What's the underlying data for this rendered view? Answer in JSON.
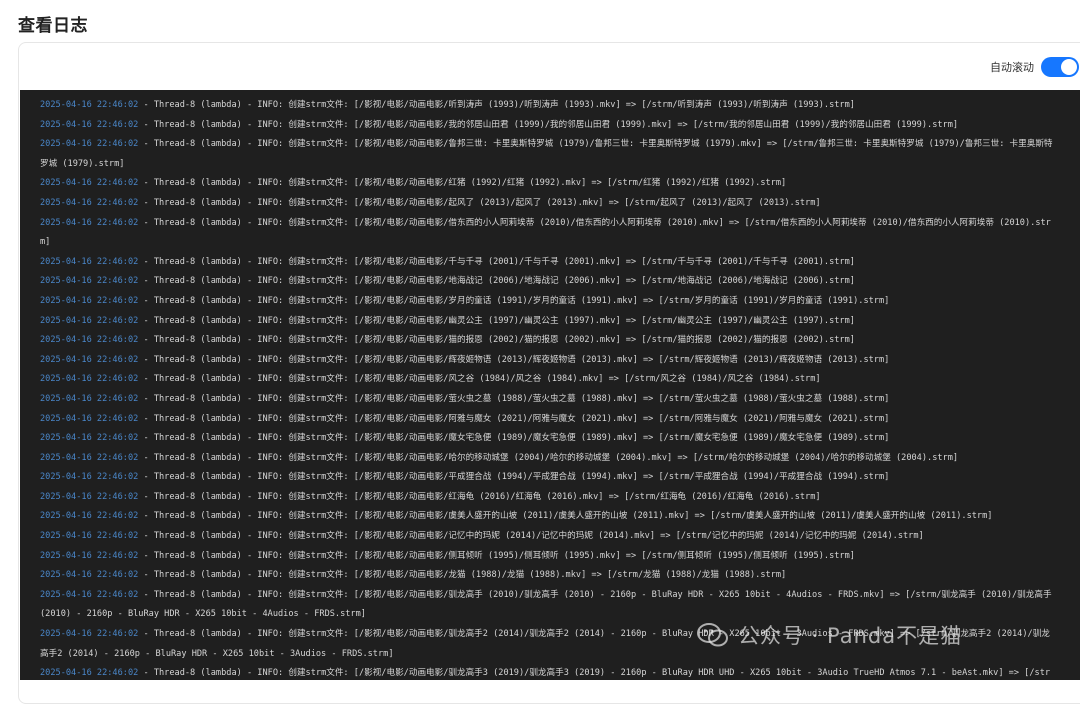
{
  "page": {
    "title": "查看日志"
  },
  "toolbar": {
    "autoscroll_label": "自动滚动",
    "autoscroll_on": true
  },
  "colors": {
    "accent": "#1677ff",
    "log_bg": "#1f1f1f",
    "timestamp": "#4a86c8",
    "log_text": "#d6d6d6"
  },
  "logs": [
    {
      "time": "2025-04-16 22:46:02",
      "text": " - Thread-8 (lambda) - INFO: 创建strm文件: [/影视/电影/动画电影/听到涛声 (1993)/听到涛声 (1993).mkv] => [/strm/听到涛声 (1993)/听到涛声 (1993).strm]"
    },
    {
      "time": "2025-04-16 22:46:02",
      "text": " - Thread-8 (lambda) - INFO: 创建strm文件: [/影视/电影/动画电影/我的邻居山田君 (1999)/我的邻居山田君 (1999).mkv] => [/strm/我的邻居山田君 (1999)/我的邻居山田君 (1999).strm]"
    },
    {
      "time": "2025-04-16 22:46:02",
      "text": " - Thread-8 (lambda) - INFO: 创建strm文件: [/影视/电影/动画电影/鲁邦三世: 卡里奥斯特罗城 (1979)/鲁邦三世: 卡里奥斯特罗城 (1979).mkv] => [/strm/鲁邦三世: 卡里奥斯特罗城 (1979)/鲁邦三世: 卡里奥斯特罗城 (1979).strm]"
    },
    {
      "time": "2025-04-16 22:46:02",
      "text": " - Thread-8 (lambda) - INFO: 创建strm文件: [/影视/电影/动画电影/红猪 (1992)/红猪 (1992).mkv] => [/strm/红猪 (1992)/红猪 (1992).strm]"
    },
    {
      "time": "2025-04-16 22:46:02",
      "text": " - Thread-8 (lambda) - INFO: 创建strm文件: [/影视/电影/动画电影/起风了 (2013)/起风了 (2013).mkv] => [/strm/起风了 (2013)/起风了 (2013).strm]"
    },
    {
      "time": "2025-04-16 22:46:02",
      "text": " - Thread-8 (lambda) - INFO: 创建strm文件: [/影视/电影/动画电影/借东西的小人阿莉埃蒂 (2010)/借东西的小人阿莉埃蒂 (2010).mkv] => [/strm/借东西的小人阿莉埃蒂 (2010)/借东西的小人阿莉埃蒂 (2010).strm]"
    },
    {
      "time": "2025-04-16 22:46:02",
      "text": " - Thread-8 (lambda) - INFO: 创建strm文件: [/影视/电影/动画电影/千与千寻 (2001)/千与千寻 (2001).mkv] => [/strm/千与千寻 (2001)/千与千寻 (2001).strm]"
    },
    {
      "time": "2025-04-16 22:46:02",
      "text": " - Thread-8 (lambda) - INFO: 创建strm文件: [/影视/电影/动画电影/地海战记 (2006)/地海战记 (2006).mkv] => [/strm/地海战记 (2006)/地海战记 (2006).strm]"
    },
    {
      "time": "2025-04-16 22:46:02",
      "text": " - Thread-8 (lambda) - INFO: 创建strm文件: [/影视/电影/动画电影/岁月的童话 (1991)/岁月的童话 (1991).mkv] => [/strm/岁月的童话 (1991)/岁月的童话 (1991).strm]"
    },
    {
      "time": "2025-04-16 22:46:02",
      "text": " - Thread-8 (lambda) - INFO: 创建strm文件: [/影视/电影/动画电影/幽灵公主 (1997)/幽灵公主 (1997).mkv] => [/strm/幽灵公主 (1997)/幽灵公主 (1997).strm]"
    },
    {
      "time": "2025-04-16 22:46:02",
      "text": " - Thread-8 (lambda) - INFO: 创建strm文件: [/影视/电影/动画电影/猫的报恩 (2002)/猫的报恩 (2002).mkv] => [/strm/猫的报恩 (2002)/猫的报恩 (2002).strm]"
    },
    {
      "time": "2025-04-16 22:46:02",
      "text": " - Thread-8 (lambda) - INFO: 创建strm文件: [/影视/电影/动画电影/辉夜姬物语 (2013)/辉夜姬物语 (2013).mkv] => [/strm/辉夜姬物语 (2013)/辉夜姬物语 (2013).strm]"
    },
    {
      "time": "2025-04-16 22:46:02",
      "text": " - Thread-8 (lambda) - INFO: 创建strm文件: [/影视/电影/动画电影/风之谷 (1984)/风之谷 (1984).mkv] => [/strm/风之谷 (1984)/风之谷 (1984).strm]"
    },
    {
      "time": "2025-04-16 22:46:02",
      "text": " - Thread-8 (lambda) - INFO: 创建strm文件: [/影视/电影/动画电影/萤火虫之墓 (1988)/萤火虫之墓 (1988).mkv] => [/strm/萤火虫之墓 (1988)/萤火虫之墓 (1988).strm]"
    },
    {
      "time": "2025-04-16 22:46:02",
      "text": " - Thread-8 (lambda) - INFO: 创建strm文件: [/影视/电影/动画电影/阿雅与魔女 (2021)/阿雅与魔女 (2021).mkv] => [/strm/阿雅与魔女 (2021)/阿雅与魔女 (2021).strm]"
    },
    {
      "time": "2025-04-16 22:46:02",
      "text": " - Thread-8 (lambda) - INFO: 创建strm文件: [/影视/电影/动画电影/魔女宅急便 (1989)/魔女宅急便 (1989).mkv] => [/strm/魔女宅急便 (1989)/魔女宅急便 (1989).strm]"
    },
    {
      "time": "2025-04-16 22:46:02",
      "text": " - Thread-8 (lambda) - INFO: 创建strm文件: [/影视/电影/动画电影/哈尔的移动城堡 (2004)/哈尔的移动城堡 (2004).mkv] => [/strm/哈尔的移动城堡 (2004)/哈尔的移动城堡 (2004).strm]"
    },
    {
      "time": "2025-04-16 22:46:02",
      "text": " - Thread-8 (lambda) - INFO: 创建strm文件: [/影视/电影/动画电影/平成狸合战 (1994)/平成狸合战 (1994).mkv] => [/strm/平成狸合战 (1994)/平成狸合战 (1994).strm]"
    },
    {
      "time": "2025-04-16 22:46:02",
      "text": " - Thread-8 (lambda) - INFO: 创建strm文件: [/影视/电影/动画电影/红海龟 (2016)/红海龟 (2016).mkv] => [/strm/红海龟 (2016)/红海龟 (2016).strm]"
    },
    {
      "time": "2025-04-16 22:46:02",
      "text": " - Thread-8 (lambda) - INFO: 创建strm文件: [/影视/电影/动画电影/虞美人盛开的山坡 (2011)/虞美人盛开的山坡 (2011).mkv] => [/strm/虞美人盛开的山坡 (2011)/虞美人盛开的山坡 (2011).strm]"
    },
    {
      "time": "2025-04-16 22:46:02",
      "text": " - Thread-8 (lambda) - INFO: 创建strm文件: [/影视/电影/动画电影/记忆中的玛妮 (2014)/记忆中的玛妮 (2014).mkv] => [/strm/记忆中的玛妮 (2014)/记忆中的玛妮 (2014).strm]"
    },
    {
      "time": "2025-04-16 22:46:02",
      "text": " - Thread-8 (lambda) - INFO: 创建strm文件: [/影视/电影/动画电影/侧耳倾听 (1995)/侧耳倾听 (1995).mkv] => [/strm/侧耳倾听 (1995)/侧耳倾听 (1995).strm]"
    },
    {
      "time": "2025-04-16 22:46:02",
      "text": " - Thread-8 (lambda) - INFO: 创建strm文件: [/影视/电影/动画电影/龙猫 (1988)/龙猫 (1988).mkv] => [/strm/龙猫 (1988)/龙猫 (1988).strm]"
    },
    {
      "time": "2025-04-16 22:46:02",
      "text": " - Thread-8 (lambda) - INFO: 创建strm文件: [/影视/电影/动画电影/驯龙高手 (2010)/驯龙高手 (2010) - 2160p - BluRay HDR - X265 10bit - 4Audios - FRDS.mkv] => [/strm/驯龙高手 (2010)/驯龙高手 (2010) - 2160p - BluRay HDR - X265 10bit - 4Audios - FRDS.strm]"
    },
    {
      "time": "2025-04-16 22:46:02",
      "text": " - Thread-8 (lambda) - INFO: 创建strm文件: [/影视/电影/动画电影/驯龙高手2 (2014)/驯龙高手2 (2014) - 2160p - BluRay HDR - X265 10bit - 3Audios - FRDS.mkv] => [/strm/驯龙高手2 (2014)/驯龙高手2 (2014) - 2160p - BluRay HDR - X265 10bit - 3Audios - FRDS.strm]"
    },
    {
      "time": "2025-04-16 22:46:02",
      "text": " - Thread-8 (lambda) - INFO: 创建strm文件: [/影视/电影/动画电影/驯龙高手3 (2019)/驯龙高手3 (2019) - 2160p - BluRay HDR UHD - X265 10bit - 3Audio TrueHD Atmos 7.1 - beAst.mkv] => [/strm/"
    }
  ],
  "watermark": {
    "text": "公众号 · Panda不是猫"
  }
}
